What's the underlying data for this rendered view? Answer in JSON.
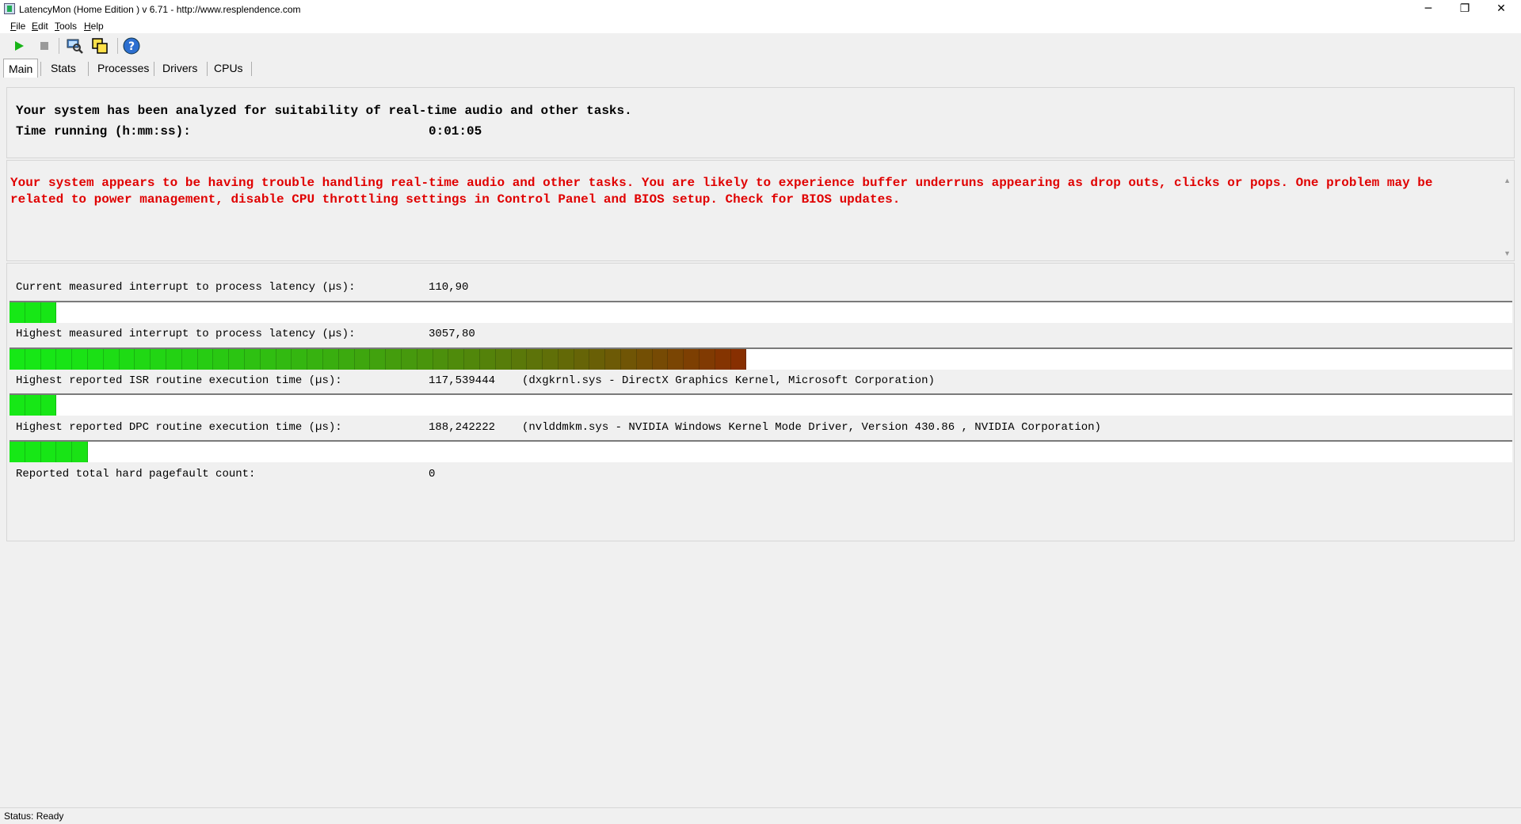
{
  "window": {
    "title": "LatencyMon  (Home Edition )  v 6.71 - http://www.resplendence.com",
    "minimize_glyph": "─",
    "restore_glyph": "❐",
    "close_glyph": "✕"
  },
  "menu": [
    "File",
    "Edit",
    "Tools",
    "Help"
  ],
  "toolbar": {
    "buttons": [
      {
        "icon": "play-icon",
        "enabled": true
      },
      {
        "icon": "stop-icon",
        "enabled": false
      },
      {
        "icon": "search-computer-icon",
        "enabled": true
      },
      {
        "icon": "windows-icon",
        "enabled": true
      },
      {
        "icon": "help-icon",
        "enabled": true
      }
    ]
  },
  "tabs": [
    "Main",
    "Stats",
    "Processes",
    "Drivers",
    "CPUs"
  ],
  "summary": {
    "analyzed": "Your system has been analyzed for suitability of real-time audio and other tasks.",
    "time_label": "Time running (h:mm:ss):",
    "time_value": "0:01:05"
  },
  "warning": {
    "line1": "Your system appears to be having trouble handling real-time audio and other tasks. You are likely to experience buffer underruns appearing as drop outs, clicks or pops. One problem may be",
    "line2": "related to power management, disable CPU throttling settings in Control Panel and BIOS setup. Check for BIOS updates.",
    "color": "#e00000"
  },
  "stats": {
    "current_latency": {
      "label": "Current measured interrupt to process latency (µs):",
      "value": "110,90",
      "bar_segments": 3
    },
    "highest_latency": {
      "label": "Highest measured interrupt to process latency (µs):",
      "value": "3057,80",
      "bar_segments": 47
    },
    "isr": {
      "label": "Highest reported ISR routine execution time (µs):",
      "value": "117,539444",
      "detail": "(dxgkrnl.sys - DirectX Graphics Kernel, Microsoft Corporation)",
      "bar_segments": 3
    },
    "dpc": {
      "label": "Highest reported DPC routine execution time (µs):",
      "value": "188,242222",
      "detail": "(nvlddmkm.sys - NVIDIA Windows Kernel Mode Driver, Version 430.86 , NVIDIA Corporation)",
      "bar_segments": 5
    },
    "pagefault": {
      "label": "Reported total hard pagefault count:",
      "value": "0"
    }
  },
  "colors": {
    "bar_good": "#16e816",
    "bar_bad": "#8a2a00"
  },
  "status": "Status: Ready"
}
